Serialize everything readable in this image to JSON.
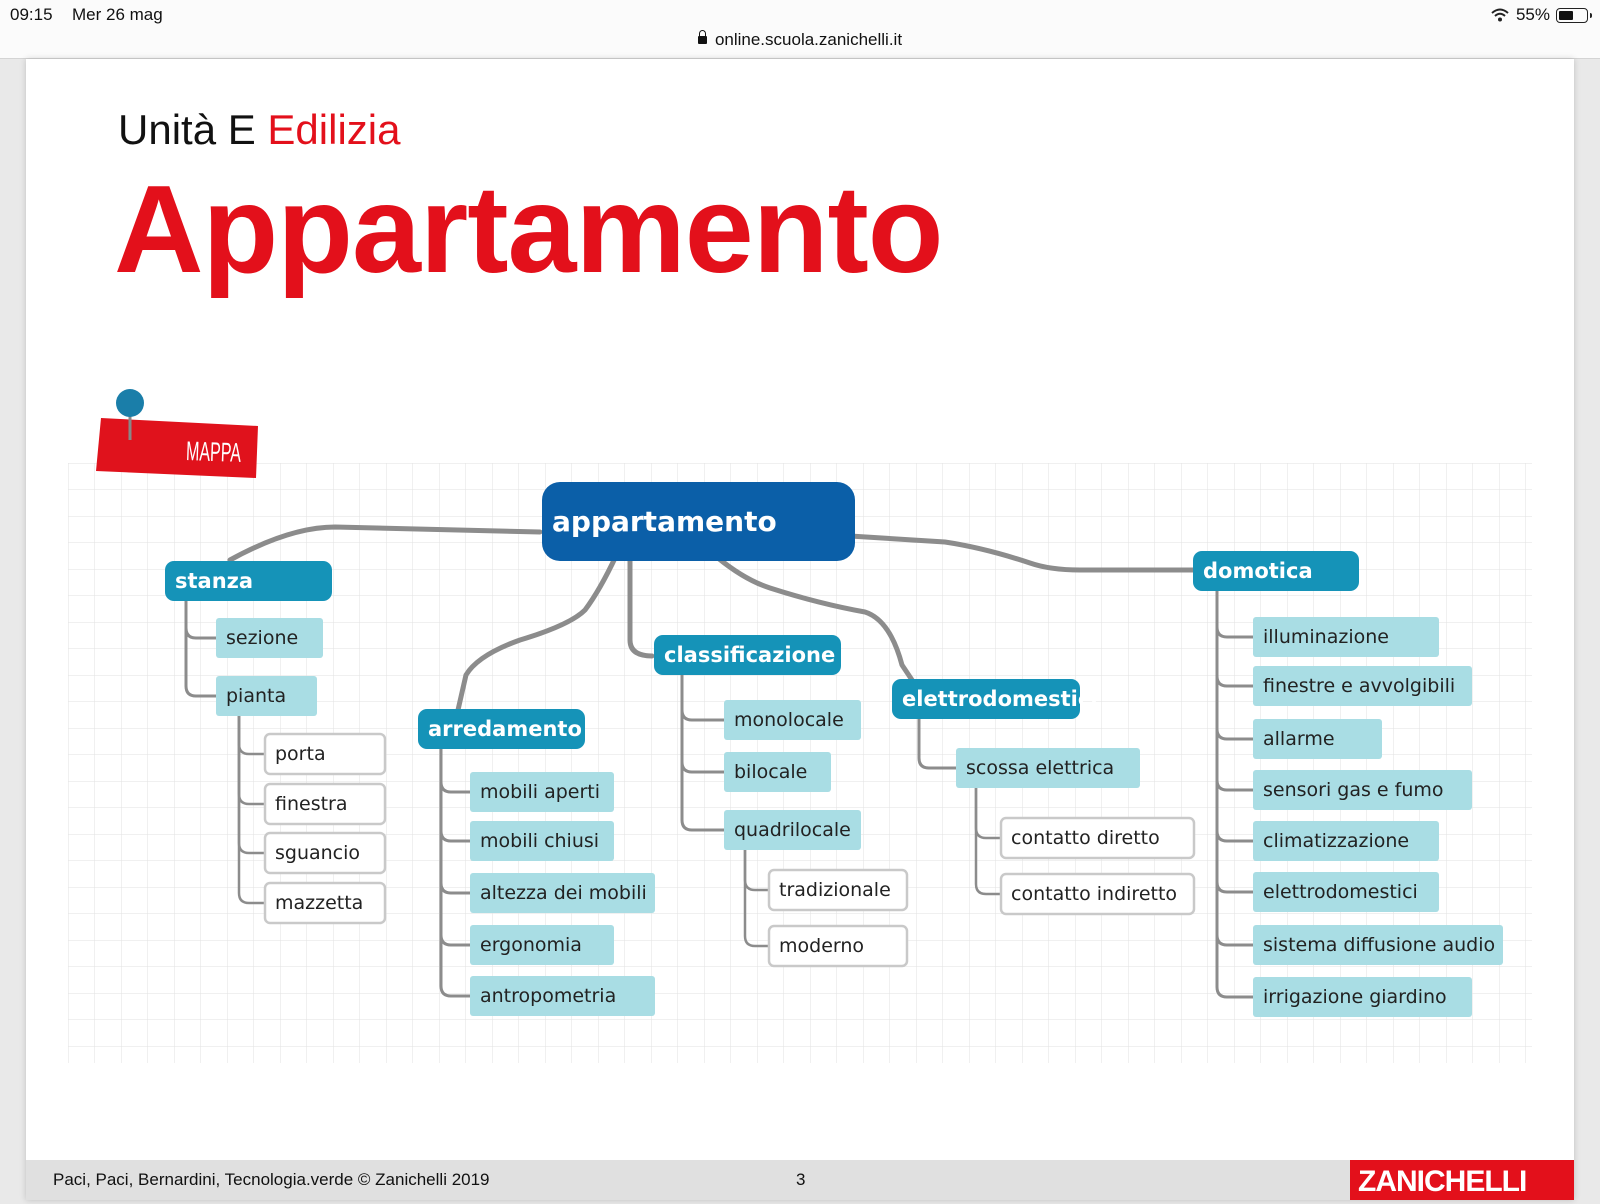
{
  "status_bar": {
    "time": "09:15",
    "date": "Mer 26 mag",
    "battery": "55%",
    "battery_level": 0.55,
    "url": "online.scuola.zanichelli.it"
  },
  "slide": {
    "unit_prefix": "Unità E",
    "unit_name": "Edilizia",
    "title": "Appartamento",
    "map_tag": "MAPPA",
    "footer_credit": "Paci, Paci, Bernardini, Tecnologia.verde © Zanichelli 2019",
    "page_number": "3",
    "publisher_logo": "ZANICHELLI"
  },
  "colors": {
    "red": "#e3101b",
    "root": "#0b5fa8",
    "branch": "#1593b8",
    "leaf": "#a9dde4",
    "outline": "#c9c9c9",
    "connector": "#8c8c8c",
    "pin": "#1a7ea9"
  },
  "mind_map": {
    "root": "appartamento",
    "branches": [
      {
        "label": "stanza",
        "children": [
          {
            "label": "sezione"
          },
          {
            "label": "pianta",
            "children": [
              "porta",
              "finestra",
              "sguancio",
              "mazzetta"
            ]
          }
        ]
      },
      {
        "label": "arredamento",
        "children": [
          {
            "label": "mobili aperti"
          },
          {
            "label": "mobili chiusi"
          },
          {
            "label": "altezza dei mobili"
          },
          {
            "label": "ergonomia"
          },
          {
            "label": "antropometria"
          }
        ]
      },
      {
        "label": "classificazione",
        "children": [
          {
            "label": "monolocale"
          },
          {
            "label": "bilocale"
          },
          {
            "label": "quadrilocale",
            "children": [
              "tradizionale",
              "moderno"
            ]
          }
        ]
      },
      {
        "label": "elettrodomestici",
        "children": [
          {
            "label": "scossa elettrica",
            "children": [
              "contatto diretto",
              "contatto indiretto"
            ]
          }
        ]
      },
      {
        "label": "domotica",
        "children": [
          {
            "label": "illuminazione"
          },
          {
            "label": "finestre e avvolgibili"
          },
          {
            "label": "allarme"
          },
          {
            "label": "sensori gas e fumo"
          },
          {
            "label": "climatizzazione"
          },
          {
            "label": "elettrodomestici"
          },
          {
            "label": "sistema diffusione audio"
          },
          {
            "label": "irrigazione giardino"
          }
        ]
      }
    ]
  }
}
